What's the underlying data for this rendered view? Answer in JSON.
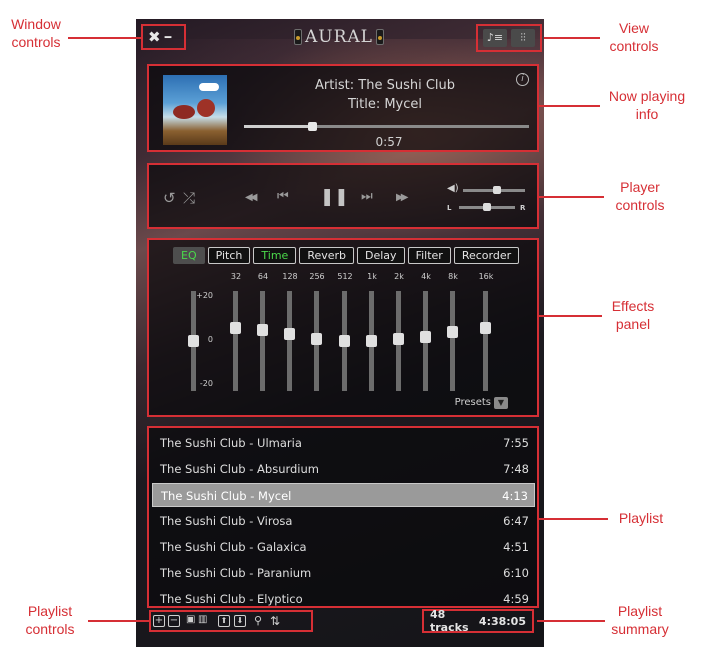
{
  "app": {
    "title": "AURAL"
  },
  "window_controls": {
    "close": "✖",
    "minimize": "━"
  },
  "view_controls": {
    "playlist_icon": "playlist-view-icon",
    "effects_icon": "effects-view-icon"
  },
  "now_playing": {
    "artist_line": "Artist: The Sushi Club",
    "title_line": "Title:  Mycel",
    "elapsed": "0:57",
    "progress": 0.24,
    "info_icon": "i"
  },
  "player": {
    "repeat_icon": "↺",
    "shuffle_icon": "⤮",
    "rewind_icon": "◀◀",
    "prev_icon": "⏮",
    "pause_icon": "❚❚",
    "next_icon": "⏭",
    "forward_icon": "▶▶",
    "volume_icon": "🔈",
    "volume": 0.55,
    "balance": 0.5,
    "balance_left": "L",
    "balance_right": "R"
  },
  "effects": {
    "tabs": [
      "EQ",
      "Pitch",
      "Time",
      "Reverb",
      "Delay",
      "Filter",
      "Recorder"
    ],
    "active_tab": "EQ",
    "gain_labels": [
      "+20",
      "0",
      "-20"
    ],
    "bands": [
      "32",
      "64",
      "128",
      "256",
      "512",
      "1k",
      "2k",
      "4k",
      "8k",
      "16k"
    ],
    "band_levels_db": [
      0,
      6,
      5,
      3,
      1,
      0,
      0,
      1,
      2,
      4,
      6
    ],
    "presets_label": "Presets"
  },
  "playlist": {
    "tracks": [
      {
        "name": "The Sushi Club - Ulmaria",
        "duration": "7:55"
      },
      {
        "name": "The Sushi Club - Absurdium",
        "duration": "7:48"
      },
      {
        "name": "The Sushi Club - Mycel",
        "duration": "4:13"
      },
      {
        "name": "The Sushi Club - Virosa",
        "duration": "6:47"
      },
      {
        "name": "The Sushi Club - Galaxica",
        "duration": "4:51"
      },
      {
        "name": "The Sushi Club - Paranium",
        "duration": "6:10"
      },
      {
        "name": "The Sushi Club - Elyptico",
        "duration": "4:59"
      }
    ],
    "selected_index": 2
  },
  "playlist_controls": {
    "add": "+",
    "remove": "−",
    "save_icon": "💾",
    "delete_icon": "🗑",
    "up": "⬆",
    "down": "⬇",
    "search_icon": "🔍",
    "sort_icon": "⇅"
  },
  "summary": {
    "tracks": "48 tracks",
    "duration": "4:38:05"
  },
  "annotations": {
    "window_controls": "Window\ncontrols",
    "view_controls": "View\ncontrols",
    "now_playing": "Now playing\ninfo",
    "player_controls": "Player\ncontrols",
    "effects_panel": "Effects\npanel",
    "playlist": "Playlist",
    "playlist_controls": "Playlist\ncontrols",
    "playlist_summary": "Playlist\nsummary"
  },
  "colors": {
    "annotation": "#d62f35",
    "active_tab": "#4bd84b"
  }
}
